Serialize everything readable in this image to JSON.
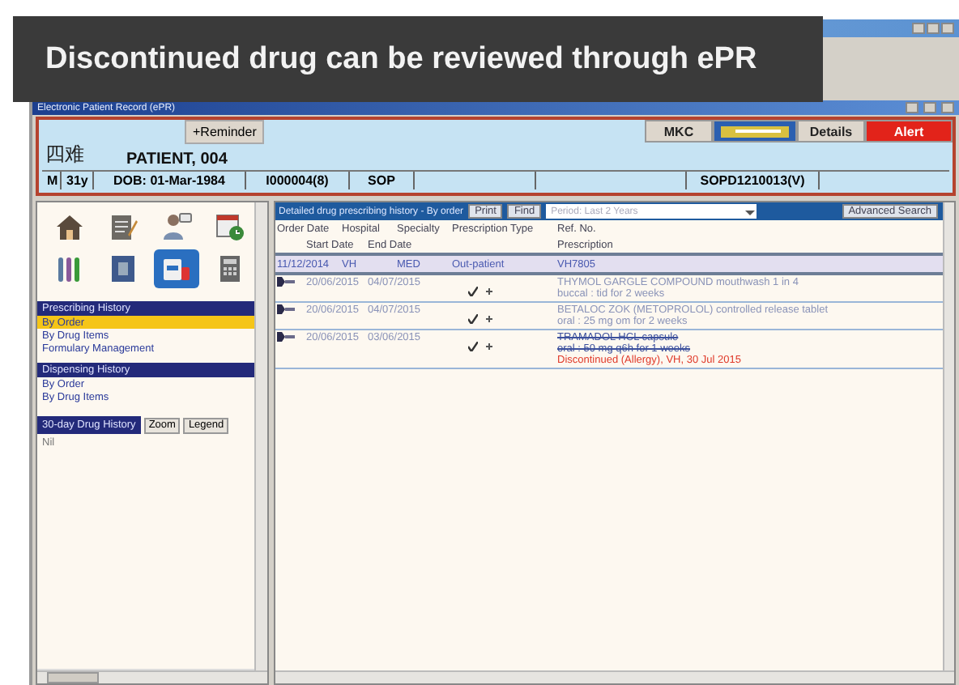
{
  "caption": "Discontinued drug can be reviewed through ePR",
  "window": {
    "title": "Electronic Patient Record (ePR)"
  },
  "header": {
    "reminder": "+Reminder",
    "buttons": [
      {
        "kind": "plain",
        "label": "MKC"
      },
      {
        "kind": "logo"
      },
      {
        "kind": "plain",
        "label": "Details"
      },
      {
        "kind": "alert",
        "label": "Alert"
      }
    ],
    "chinese_name": "四难",
    "name": "PATIENT, 004",
    "fields": [
      "M",
      "31y",
      "DOB: 01-Mar-1984",
      "I000004(8)",
      "SOP",
      "SOPD1210013(V)"
    ]
  },
  "sidebar": {
    "tools": [
      {
        "kind": "home",
        "selected": false
      },
      {
        "kind": "notes",
        "selected": false
      },
      {
        "kind": "doctor",
        "selected": false
      },
      {
        "kind": "calendar",
        "selected": false
      },
      {
        "kind": "lab",
        "selected": false
      },
      {
        "kind": "xray",
        "selected": false
      },
      {
        "kind": "medicine",
        "selected": true
      },
      {
        "kind": "calculator",
        "selected": false
      }
    ],
    "sections": [
      {
        "title": "Prescribing History",
        "items": [
          {
            "label": "By Order",
            "selected": true
          },
          {
            "label": "By Drug Items",
            "selected": false
          },
          {
            "label": "Formulary Management",
            "selected": false
          }
        ]
      },
      {
        "title": "Dispensing History",
        "items": [
          {
            "label": "By Order",
            "selected": false
          },
          {
            "label": "By Drug Items",
            "selected": false
          }
        ]
      }
    ],
    "drug_history": {
      "title": "30-day Drug History",
      "buttons": [
        "Zoom",
        "Legend"
      ],
      "content": "Nil"
    }
  },
  "main": {
    "title": "Detailed drug prescribing history - By order",
    "print": "Print",
    "find": "Find",
    "period": "Period: Last 2 Years",
    "advanced": "Advanced Search",
    "columns_1": [
      "Order Date",
      "Hospital",
      "Specialty",
      "Prescription Type",
      "Ref. No."
    ],
    "columns_2": [
      "Start Date",
      "End Date",
      "Prescription"
    ],
    "rows": [
      {
        "kind": "order",
        "cells": [
          "11/12/2014",
          "VH",
          "MED",
          "Out-patient",
          "VH7805"
        ]
      },
      {
        "kind": "drug",
        "start": "20/06/2015",
        "end": "04/07/2015",
        "lines": [
          "THYMOL GARGLE COMPOUND mouthwash 1 in 4",
          "buccal : tid for 2 weeks"
        ],
        "discontinued": false
      },
      {
        "kind": "drug",
        "start": "20/06/2015",
        "end": "04/07/2015",
        "lines": [
          "BETALOC ZOK (METOPROLOL) controlled release tablet",
          "oral : 25 mg om for 2 weeks"
        ],
        "discontinued": false
      },
      {
        "kind": "drug",
        "start": "20/06/2015",
        "end": "03/06/2015",
        "lines": [
          "TRAMADOL HCL capsule",
          "oral : 50 mg q6h for 1 weeks"
        ],
        "discontinued": true,
        "note": "Discontinued (Allergy), VH, 30 Jul 2015"
      }
    ]
  }
}
